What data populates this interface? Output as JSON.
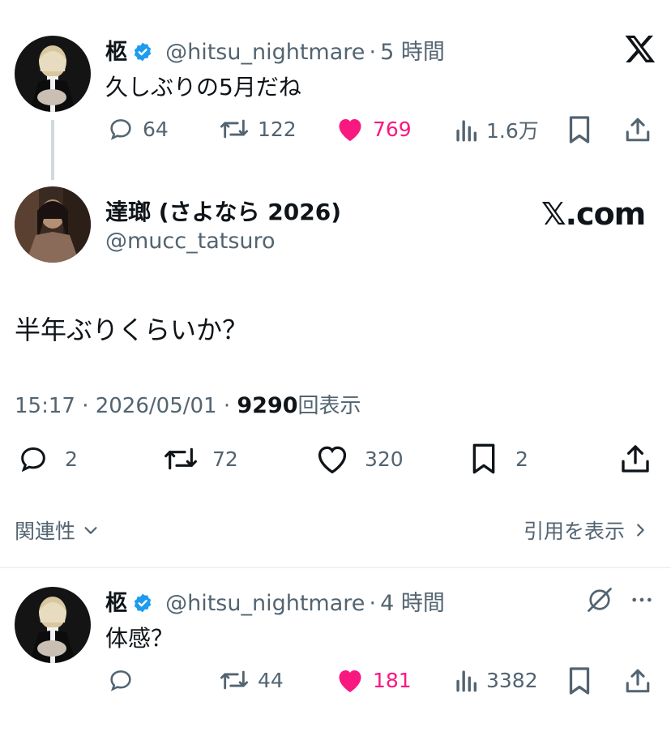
{
  "tweet1": {
    "name": "柩",
    "handle": "@hitsu_nightmare",
    "separator": "·",
    "time": "5 時間",
    "text": "久しぶりの5月だね",
    "replies": "64",
    "retweets": "122",
    "likes": "769",
    "views": "1.6万"
  },
  "quoted": {
    "name": "達瑯 (さよなら 2026)",
    "handle": "@mucc_tatsuro",
    "brand": "𝕏.com",
    "text": "半年ぶりくらいか？",
    "timestamp": "15:17 · 2026/05/01 ·",
    "views_count": "9290",
    "views_label": "回表示",
    "replies": "2",
    "retweets": "72",
    "likes": "320",
    "bookmarks": "2",
    "related_label": "関連性",
    "show_quotes_label": "引用を表示"
  },
  "tweet2": {
    "name": "柩",
    "handle": "@hitsu_nightmare",
    "separator": "·",
    "time": "4 時間",
    "text": "体感？",
    "retweets": "44",
    "likes": "181",
    "views": "3382"
  },
  "colors": {
    "like": "#f91880",
    "verified": "#1d9bf0",
    "muted": "#536471",
    "text": "#0f1419"
  }
}
